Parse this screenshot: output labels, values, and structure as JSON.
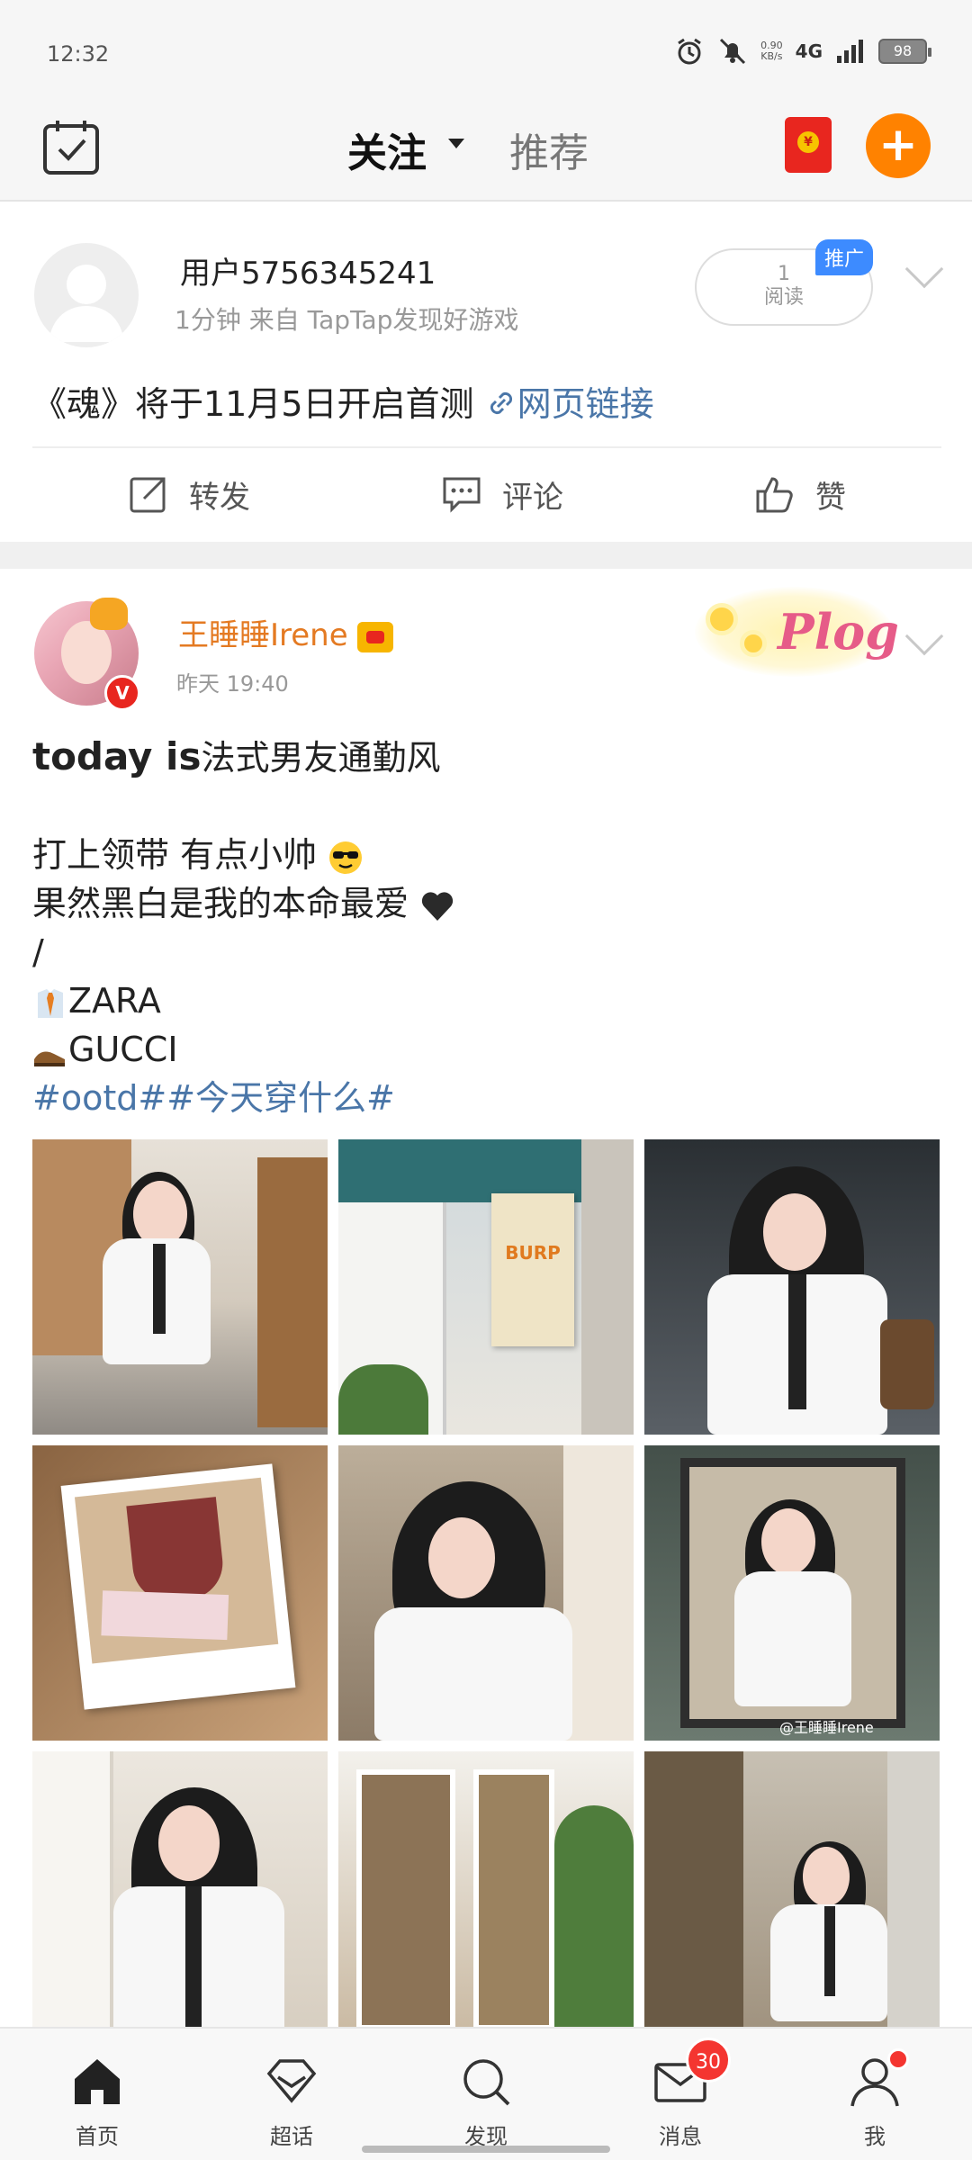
{
  "status_bar": {
    "time": "12:32",
    "net_speed": "0.90",
    "net_unit": "KB/s",
    "network": "4G",
    "battery": "98"
  },
  "top_nav": {
    "tab_follow": "关注",
    "tab_recommend": "推荐"
  },
  "post1": {
    "username": "用户5756345241",
    "meta": "1分钟  来自 TapTap发现好游戏",
    "read_count": "1",
    "read_label": "阅读",
    "promo_label": "推广",
    "text": "《魂》将于11月5日开启首测",
    "link_text": "网页链接",
    "actions": {
      "repost": "转发",
      "comment": "评论",
      "like": "赞"
    }
  },
  "post2": {
    "username": "王睡睡Irene",
    "time": "昨天 19:40",
    "sticker_text": "Plog",
    "title_bold": "today is",
    "title_rest": "法式男友通勤风",
    "line1": "打上领带 有点小帅",
    "line2": "果然黑白是我的本命最爱",
    "slash": "/",
    "brand1": "ZARA",
    "brand2": "GUCCI",
    "tags": "#ootd##今天穿什么#",
    "photos": [
      {
        "alt": "girl-in-white-shirt-at-cafe-door"
      },
      {
        "alt": "burp-shop-sign",
        "sign_text": "BURP"
      },
      {
        "alt": "girl-with-bag-closeup"
      },
      {
        "alt": "polaroid-drink-and-tickets"
      },
      {
        "alt": "girl-sitting-cafe"
      },
      {
        "alt": "girl-framed-poster",
        "watermark": "@王睡睡Irene"
      },
      {
        "alt": "girl-holding-drink"
      },
      {
        "alt": "cafe-windows"
      },
      {
        "alt": "girl-sitting-outdoor"
      }
    ]
  },
  "bottom_nav": {
    "home": "首页",
    "super_topic": "超话",
    "discover": "发现",
    "messages": "消息",
    "messages_badge": "30",
    "me": "我"
  }
}
